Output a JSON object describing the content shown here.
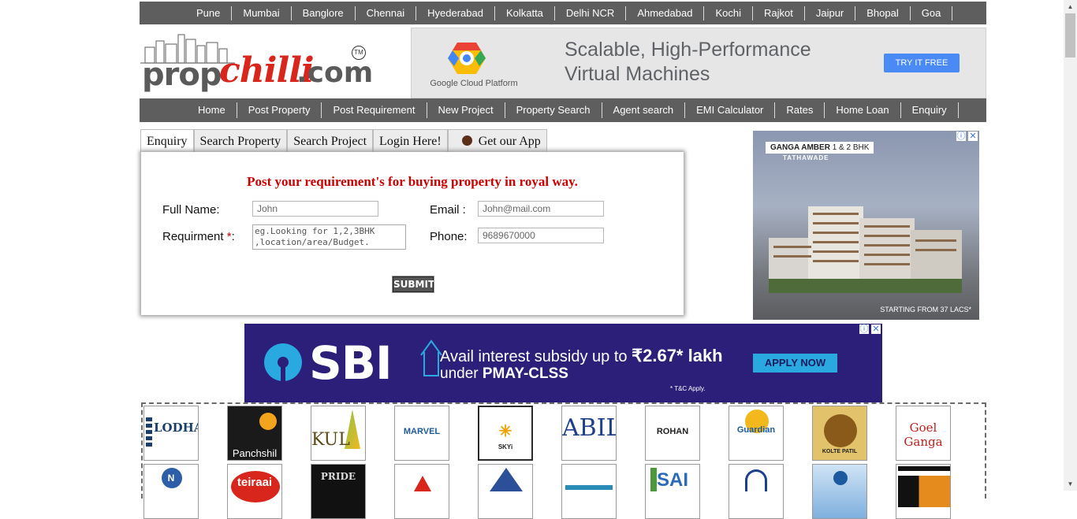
{
  "cities": [
    "Pune",
    "Mumbai",
    "Banglore",
    "Chennai",
    "Hyederabad",
    "Kolkatta",
    "Delhi NCR",
    "Ahmedabad",
    "Kochi",
    "Rajkot",
    "Jaipur",
    "Bhopal",
    "Goa"
  ],
  "logo": {
    "prop": "prop",
    "chilli": "chilli",
    "dotcom": ".com",
    "tm": "TM"
  },
  "google_ad": {
    "brand": "Google Cloud Platform",
    "headline_1": "Scalable, High-Performance",
    "headline_2": "Virtual Machines",
    "cta": "TRY IT FREE"
  },
  "nav": [
    "Home",
    "Post Property",
    "Post Requirement",
    "New Project",
    "Property Search",
    "Agent search",
    "EMI Calculator",
    "Rates",
    "Home Loan",
    "Enquiry"
  ],
  "tabs": [
    "Enquiry",
    "Search Property",
    "Search Project",
    "Login Here!",
    "Get our App"
  ],
  "form": {
    "heading": "Post your requirement's for buying property in royal way.",
    "full_name_label": "Full Name:",
    "full_name_placeholder": "John",
    "email_label": "Email :",
    "email_placeholder": "John@mail.com",
    "requirement_label": "Requirment",
    "required_mark": "*",
    "requirement_colon": ":",
    "requirement_placeholder": "eg.Looking for 1,2,3BHK ,location/area/Budget.",
    "phone_label": "Phone:",
    "phone_placeholder": "9689670000",
    "submit": "SUBMIT"
  },
  "right_ad": {
    "tag": "GANGA AMBER",
    "tag_suffix": "1 & 2 BHK",
    "location": "TATHAWADE",
    "footer": "STARTING FROM 37 LACS*"
  },
  "sbi_ad": {
    "brand": "SBI",
    "line1_prefix": "Avail interest subsidy up to ",
    "amount": "₹2.67* lakh",
    "line2_prefix": "under ",
    "scheme": "PMAY-CLSS",
    "cta": "APPLY NOW",
    "tnc": "* T&C Apply."
  },
  "builders_row1": [
    "LODHA",
    "Panchshil",
    "KUL",
    "MARVEL",
    "SKYi",
    "ABIL",
    "ROHAN",
    "Guardian",
    "KOLTE PATIL",
    "Goel Ganga"
  ],
  "builders_row2": [
    "N",
    "teiraai",
    "PRIDE",
    "",
    "",
    "",
    "SAI",
    "",
    "",
    ""
  ],
  "colors": {
    "nav_bg": "#5e5e5e",
    "heading_red": "#cc0000",
    "sbi_purple": "#2b1f79",
    "sbi_blue": "#2aa8e0"
  }
}
